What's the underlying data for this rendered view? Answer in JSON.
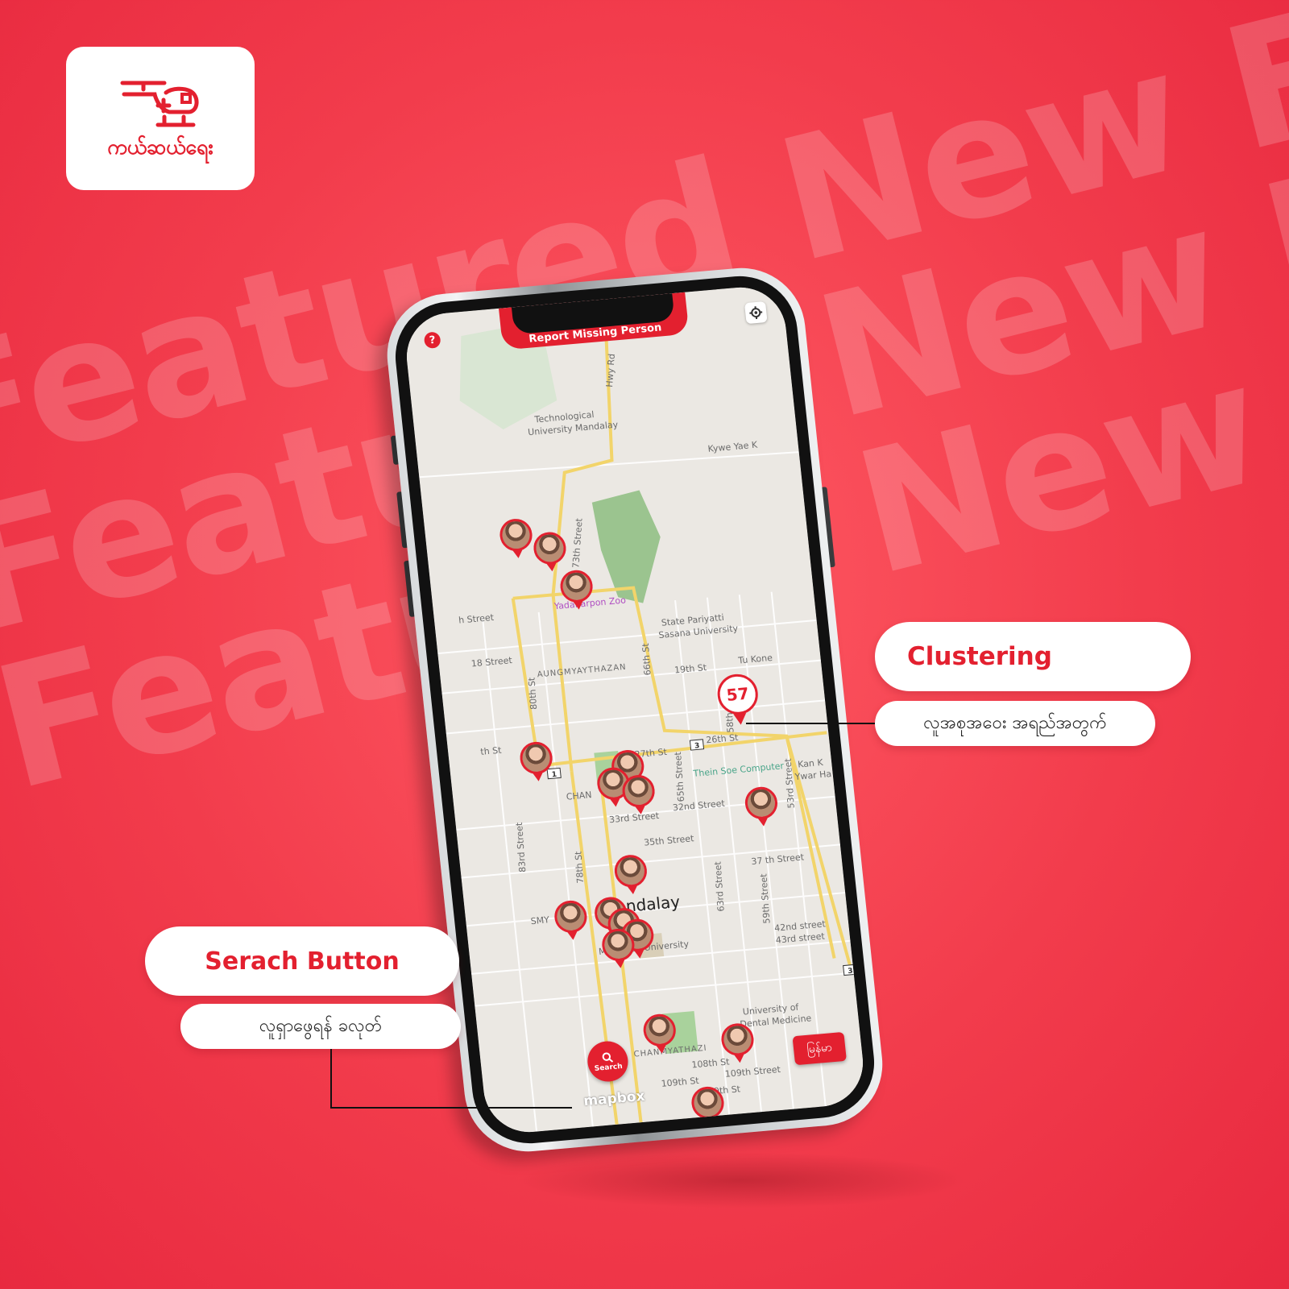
{
  "brand": {
    "name": "ကယ်ဆယ်ရေး"
  },
  "background": {
    "watermark_lines": [
      "Featured New Fea",
      "Featured New F",
      "Featured New Fe"
    ]
  },
  "callouts": {
    "clustering": {
      "title": "Clustering",
      "subtitle": "လူအစုအဝေး အရည်အတွက်"
    },
    "search": {
      "title": "Serach Button",
      "subtitle": "လူရှာဖွေရန် ခလုတ်"
    }
  },
  "app": {
    "report_button": "Report Missing Person",
    "help_icon": "?",
    "cluster_count": "57",
    "search_label": "Search",
    "language_button": "မြန်မာ",
    "map_attribution": "mapbox",
    "map_labels": {
      "l1": "Technological",
      "l2": "University Mandalay",
      "l3": "Hwy Rd",
      "l4": "Kywe Yae K",
      "l5": "Yadanarpon Zoo",
      "l6": "State Pariyatti",
      "l7": "Sasana University",
      "l8": "AUNGMYAYTHAZAN",
      "l9": "18 Street",
      "l10": "19th St",
      "l11": "Tu Kone",
      "l12": "26th St",
      "l13": "27th St",
      "l14": "Thein Soe Computer",
      "l15": "Kan K",
      "l16": "Ywar Ha",
      "l17": "32nd Street",
      "l18": "33rd Street",
      "l19": "35th Street",
      "l20": "37 th Street",
      "l21": "Mandalay",
      "l22": "Mandalay University",
      "l23": "42nd street",
      "l24": "43rd street",
      "l25": "University of",
      "l26": "Dental Medicine",
      "l27": "CHANMYATHAZI",
      "l28": "108th St",
      "l29": "109th St",
      "l30": "109th Street",
      "l31": "110th St",
      "l32": "80th St",
      "l33": "66th St",
      "l34": "83rd Street",
      "l35": "78th St",
      "l36": "65th Street",
      "l37": "63rd Street",
      "l38": "59th Street",
      "l39": "53rd Street",
      "l40": "58th Street",
      "l41": "CHAN",
      "l42": "h Street",
      "l43": "th St",
      "l44": "73th Street",
      "l45": "SMY"
    },
    "route_badges": [
      "1",
      "3",
      "3"
    ]
  },
  "colors": {
    "brand_red": "#e3202f",
    "background": "#f23c4c"
  }
}
